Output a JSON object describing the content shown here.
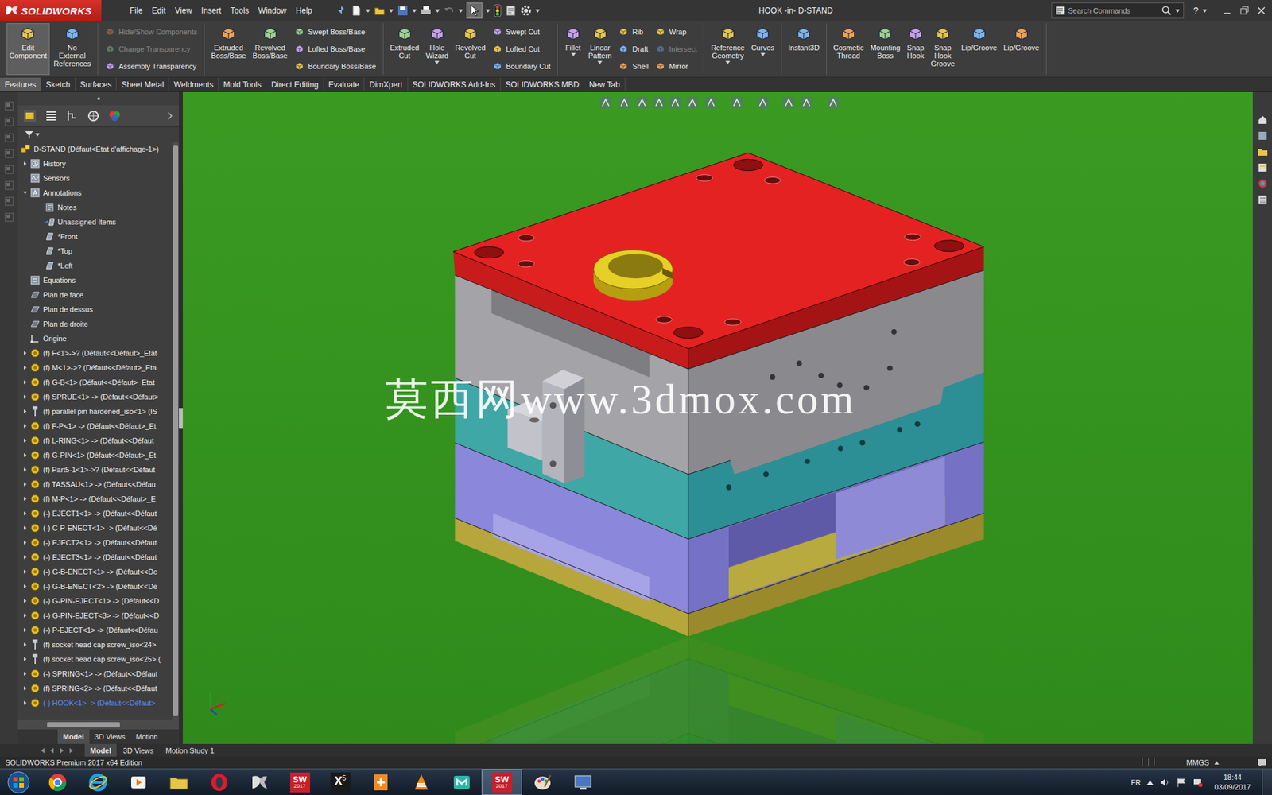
{
  "app": {
    "logo": "SOLIDWORKS"
  },
  "menu": [
    "File",
    "Edit",
    "View",
    "Insert",
    "Tools",
    "Window",
    "Help"
  ],
  "window": {
    "title": "HOOK -in- D-STAND"
  },
  "search": {
    "placeholder": "Search Commands"
  },
  "help": "?",
  "ribbon": {
    "groups": [
      {
        "columns": [
          {
            "kind": "large",
            "label": "Edit Component",
            "pressed": true,
            "disabled": false,
            "dropdown": false
          },
          {
            "kind": "large",
            "label": "No External References",
            "pressed": false,
            "disabled": false,
            "dropdown": false
          }
        ]
      },
      {
        "columns": [
          {
            "kind": "stack",
            "items": [
              {
                "label": "Hide/Show Components",
                "disabled": true
              },
              {
                "label": "Change Transparency",
                "disabled": true
              },
              {
                "label": "Assembly Transparency",
                "disabled": false
              }
            ]
          }
        ]
      },
      {
        "columns": [
          {
            "kind": "large",
            "label": "Extruded Boss/Base",
            "pressed": false,
            "disabled": false,
            "dropdown": false
          },
          {
            "kind": "large",
            "label": "Revolved Boss/Base",
            "pressed": false,
            "disabled": false,
            "dropdown": false
          },
          {
            "kind": "stack",
            "items": [
              {
                "label": "Swept Boss/Base",
                "disabled": false
              },
              {
                "label": "Lofted Boss/Base",
                "disabled": false
              },
              {
                "label": "Boundary Boss/Base",
                "disabled": false
              }
            ]
          }
        ]
      },
      {
        "columns": [
          {
            "kind": "large",
            "label": "Extruded Cut",
            "pressed": false,
            "disabled": false,
            "dropdown": false
          },
          {
            "kind": "large",
            "label": "Hole Wizard",
            "pressed": false,
            "disabled": false,
            "dropdown": true
          },
          {
            "kind": "large",
            "label": "Revolved Cut",
            "pressed": false,
            "disabled": false,
            "dropdown": false
          },
          {
            "kind": "stack",
            "items": [
              {
                "label": "Swept Cut",
                "disabled": false
              },
              {
                "label": "Lofted Cut",
                "disabled": false
              },
              {
                "label": "Boundary Cut",
                "disabled": false
              }
            ]
          }
        ]
      },
      {
        "columns": [
          {
            "kind": "large",
            "label": "Fillet",
            "pressed": false,
            "disabled": false,
            "dropdown": true
          },
          {
            "kind": "large",
            "label": "Linear Pattern",
            "pressed": false,
            "disabled": false,
            "dropdown": true
          },
          {
            "kind": "stack",
            "items": [
              {
                "label": "Rib",
                "disabled": false
              },
              {
                "label": "Draft",
                "disabled": false
              },
              {
                "label": "Shell",
                "disabled": false
              }
            ]
          },
          {
            "kind": "stack",
            "items": [
              {
                "label": "Wrap",
                "disabled": false
              },
              {
                "label": "Intersect",
                "disabled": true
              },
              {
                "label": "Mirror",
                "disabled": false
              }
            ]
          }
        ]
      },
      {
        "columns": [
          {
            "kind": "large",
            "label": "Reference Geometry",
            "pressed": false,
            "disabled": false,
            "dropdown": true
          },
          {
            "kind": "large",
            "label": "Curves",
            "pressed": false,
            "disabled": false,
            "dropdown": true
          }
        ]
      },
      {
        "columns": [
          {
            "kind": "large",
            "label": "Instant3D",
            "pressed": false,
            "disabled": false,
            "dropdown": false
          }
        ]
      },
      {
        "columns": [
          {
            "kind": "large",
            "label": "Cosmetic Thread",
            "pressed": false,
            "disabled": false,
            "dropdown": false
          },
          {
            "kind": "large",
            "label": "Mounting Boss",
            "pressed": false,
            "disabled": false,
            "dropdown": false
          },
          {
            "kind": "large",
            "label": "Snap Hook",
            "pressed": false,
            "disabled": false,
            "dropdown": false
          },
          {
            "kind": "large",
            "label": "Snap Hook Groove",
            "pressed": false,
            "disabled": false,
            "dropdown": false
          },
          {
            "kind": "large",
            "label": "Lip/Groove",
            "pressed": false,
            "disabled": false,
            "dropdown": false
          },
          {
            "kind": "large",
            "label": "Lip/Groove",
            "pressed": false,
            "disabled": false,
            "dropdown": false
          }
        ]
      }
    ]
  },
  "tabs": [
    {
      "label": "Features",
      "selected": true
    },
    {
      "label": "Sketch",
      "selected": false
    },
    {
      "label": "Surfaces",
      "selected": false
    },
    {
      "label": "Sheet Metal",
      "selected": false
    },
    {
      "label": "Weldments",
      "selected": false
    },
    {
      "label": "Mold Tools",
      "selected": false
    },
    {
      "label": "Direct Editing",
      "selected": false
    },
    {
      "label": "Evaluate",
      "selected": false
    },
    {
      "label": "DimXpert",
      "selected": false
    },
    {
      "label": "SOLIDWORKS Add-Ins",
      "selected": false
    },
    {
      "label": "SOLIDWORKS MBD",
      "selected": false
    },
    {
      "label": "New Tab",
      "selected": false
    }
  ],
  "tree": {
    "items": [
      {
        "label": "D-STAND (Défaut<Etat d'affichage-1>)",
        "kind": "root",
        "level": 0,
        "expandable": false,
        "expanded": true,
        "selected": false
      },
      {
        "label": "History",
        "kind": "history",
        "level": 1,
        "expandable": true,
        "expanded": false,
        "selected": false
      },
      {
        "label": "Sensors",
        "kind": "sensor",
        "level": 1,
        "expandable": false,
        "expanded": false,
        "selected": false
      },
      {
        "label": "Annotations",
        "kind": "annotations",
        "level": 1,
        "expandable": true,
        "expanded": true,
        "selected": false
      },
      {
        "label": "Notes",
        "kind": "note",
        "level": 2,
        "expandable": false,
        "expanded": false,
        "selected": false
      },
      {
        "label": "Unassigned Items",
        "kind": "unassigned",
        "level": 2,
        "expandable": false,
        "expanded": false,
        "selected": false
      },
      {
        "label": "*Front",
        "kind": "view",
        "level": 2,
        "expandable": false,
        "expanded": false,
        "selected": false
      },
      {
        "label": "*Top",
        "kind": "view",
        "level": 2,
        "expandable": false,
        "expanded": false,
        "selected": false
      },
      {
        "label": "*Left",
        "kind": "view",
        "level": 2,
        "expandable": false,
        "expanded": false,
        "selected": false
      },
      {
        "label": "Equations",
        "kind": "equations",
        "level": 1,
        "expandable": false,
        "expanded": false,
        "selected": false
      },
      {
        "label": "Plan de face",
        "kind": "plane",
        "level": 1,
        "expandable": false,
        "expanded": false,
        "selected": false
      },
      {
        "label": "Plan de dessus",
        "kind": "plane",
        "level": 1,
        "expandable": false,
        "expanded": false,
        "selected": false
      },
      {
        "label": "Plan de droite",
        "kind": "plane",
        "level": 1,
        "expandable": false,
        "expanded": false,
        "selected": false
      },
      {
        "label": "Origine",
        "kind": "origin",
        "level": 1,
        "expandable": false,
        "expanded": false,
        "selected": false
      },
      {
        "label": "(f) F<1>->? (Défaut<<Défaut>_Etat",
        "kind": "part",
        "level": 1,
        "expandable": true,
        "expanded": false,
        "selected": false
      },
      {
        "label": "(f) M<1>->? (Défaut<<Défaut>_Eta",
        "kind": "part",
        "level": 1,
        "expandable": true,
        "expanded": false,
        "selected": false
      },
      {
        "label": "(f) G-B<1> (Défaut<<Défaut>_Etat",
        "kind": "part",
        "level": 1,
        "expandable": true,
        "expanded": false,
        "selected": false
      },
      {
        "label": "(f) SPRUE<1> -> (Défaut<<Défaut>",
        "kind": "part",
        "level": 1,
        "expandable": true,
        "expanded": false,
        "selected": false
      },
      {
        "label": "(f) parallel pin hardened_iso<1> (IS",
        "kind": "fastener",
        "level": 1,
        "expandable": true,
        "expanded": false,
        "selected": false
      },
      {
        "label": "(f) F-P<1> -> (Défaut<<Défaut>_Et",
        "kind": "part",
        "level": 1,
        "expandable": true,
        "expanded": false,
        "selected": false
      },
      {
        "label": "(f) L-RING<1> -> (Défaut<<Défaut",
        "kind": "part",
        "level": 1,
        "expandable": true,
        "expanded": false,
        "selected": false
      },
      {
        "label": "(f) G-PIN<1> (Défaut<<Défaut>_Et",
        "kind": "part",
        "level": 1,
        "expandable": true,
        "expanded": false,
        "selected": false
      },
      {
        "label": "(f) Part5-1<1>->? (Défaut<<Défaut",
        "kind": "part",
        "level": 1,
        "expandable": true,
        "expanded": false,
        "selected": false
      },
      {
        "label": "(f) TASSAU<1> -> (Défaut<<Défau",
        "kind": "part",
        "level": 1,
        "expandable": true,
        "expanded": false,
        "selected": false
      },
      {
        "label": "(f) M-P<1> -> (Défaut<<Défaut>_E",
        "kind": "part",
        "level": 1,
        "expandable": true,
        "expanded": false,
        "selected": false
      },
      {
        "label": "(-) EJECT1<1> -> (Défaut<<Défaut",
        "kind": "part",
        "level": 1,
        "expandable": true,
        "expanded": false,
        "selected": false
      },
      {
        "label": "(-) C-P-ENECT<1> -> (Défaut<<Dé",
        "kind": "part",
        "level": 1,
        "expandable": true,
        "expanded": false,
        "selected": false
      },
      {
        "label": "(-) EJECT2<1> -> (Défaut<<Défaut",
        "kind": "part",
        "level": 1,
        "expandable": true,
        "expanded": false,
        "selected": false
      },
      {
        "label": "(-) EJECT3<1> -> (Défaut<<Défaut",
        "kind": "part",
        "level": 1,
        "expandable": true,
        "expanded": false,
        "selected": false
      },
      {
        "label": "(-) G-B-ENECT<1> -> (Défaut<<De",
        "kind": "part",
        "level": 1,
        "expandable": true,
        "expanded": false,
        "selected": false
      },
      {
        "label": "(-) G-B-ENECT<2> -> (Défaut<<De",
        "kind": "part",
        "level": 1,
        "expandable": true,
        "expanded": false,
        "selected": false
      },
      {
        "label": "(-) G-PIN-EJECT<1> -> (Défaut<<D",
        "kind": "part",
        "level": 1,
        "expandable": true,
        "expanded": false,
        "selected": false
      },
      {
        "label": "(-) G-PIN-EJECT<3> -> (Défaut<<D",
        "kind": "part",
        "level": 1,
        "expandable": true,
        "expanded": false,
        "selected": false
      },
      {
        "label": "(-) P-EJECT<1> -> (Défaut<<Défau",
        "kind": "part",
        "level": 1,
        "expandable": true,
        "expanded": false,
        "selected": false
      },
      {
        "label": "(f) socket head cap screw_iso<24>",
        "kind": "fastener",
        "level": 1,
        "expandable": true,
        "expanded": false,
        "selected": false
      },
      {
        "label": "(f) socket head cap screw_iso<25> (",
        "kind": "fastener",
        "level": 1,
        "expandable": true,
        "expanded": false,
        "selected": false
      },
      {
        "label": "(-) SPRING<1> -> (Défaut<<Défaut",
        "kind": "part",
        "level": 1,
        "expandable": true,
        "expanded": false,
        "selected": false
      },
      {
        "label": "(f) SPRING<2> -> (Défaut<<Défaut",
        "kind": "part",
        "level": 1,
        "expandable": true,
        "expanded": false,
        "selected": false
      },
      {
        "label": "(-) HOOK<1> -> (Défaut<<Défaut>",
        "kind": "part",
        "level": 1,
        "expandable": true,
        "expanded": false,
        "selected": true
      }
    ]
  },
  "panel_tabs": [
    {
      "label": "Model",
      "selected": true
    },
    {
      "label": "3D Views",
      "selected": false
    },
    {
      "label": "Motion",
      "selected": false
    }
  ],
  "bottom_tabs": [
    {
      "label": "Model",
      "selected": true
    },
    {
      "label": "3D Views",
      "selected": false
    },
    {
      "label": "Motion Study 1",
      "selected": false
    }
  ],
  "viewport": {
    "watermark": "莫西网www.3dmox.com"
  },
  "status_bar": {
    "edition": "SOLIDWORKS Premium 2017 x64 Edition",
    "units": "MMGS"
  },
  "taskbar": {
    "apps": [
      {
        "kind": "chrome",
        "active": false
      },
      {
        "kind": "ie",
        "active": false
      },
      {
        "kind": "media",
        "active": false
      },
      {
        "kind": "explorer",
        "active": false
      },
      {
        "kind": "opera",
        "active": false
      },
      {
        "kind": "ds",
        "active": false
      },
      {
        "kind": "sw",
        "text": "SW",
        "sub": "2017",
        "active": false
      },
      {
        "kind": "x5",
        "text": "X",
        "sub": "5",
        "active": false
      },
      {
        "kind": "pdf",
        "active": false
      },
      {
        "kind": "vlc",
        "active": false
      },
      {
        "kind": "app",
        "active": false
      },
      {
        "kind": "sw",
        "text": "SW",
        "sub": "2017",
        "active": true
      },
      {
        "kind": "paint",
        "active": false
      },
      {
        "kind": "screen",
        "active": false
      }
    ],
    "lang": "FR",
    "time": "18:44",
    "date": "03/09/2017"
  }
}
